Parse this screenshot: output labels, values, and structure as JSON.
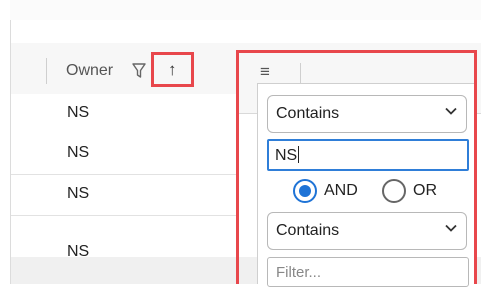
{
  "grid": {
    "column_owner_label": "Owner",
    "rows": [
      "NS",
      "NS",
      "NS",
      "NS"
    ]
  },
  "icons": {
    "filter": "filter-icon",
    "sort": "↑",
    "menu": "≡"
  },
  "filter_panel": {
    "condition1": {
      "operator": "Contains",
      "value": "NS"
    },
    "join": {
      "and_label": "AND",
      "or_label": "OR",
      "selected": "AND"
    },
    "condition2": {
      "operator": "Contains",
      "placeholder": "Filter..."
    }
  },
  "colors": {
    "highlight": "#e8474c",
    "accent": "#1e73d6",
    "focus": "#2f7ed8"
  }
}
